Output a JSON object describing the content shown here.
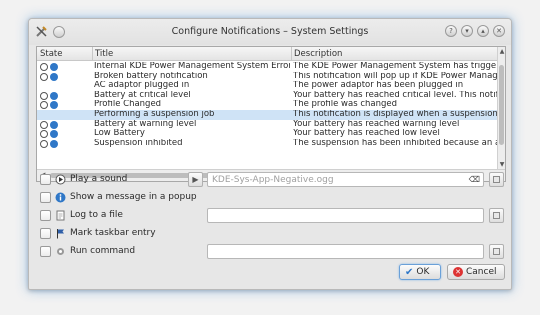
{
  "window": {
    "title": "Configure Notifications – System Settings"
  },
  "table": {
    "headers": {
      "state": "State",
      "title": "Title",
      "description": "Description"
    },
    "rows": [
      {
        "title": "Internal KDE Power Management System Error",
        "description": "The KDE Power Management System has trigge",
        "play": true,
        "info": true,
        "selected": false
      },
      {
        "title": "Broken battery notification",
        "description": "This notification will pop up if KDE Power Manage",
        "play": true,
        "info": true,
        "selected": false
      },
      {
        "title": "AC adaptor plugged in",
        "description": "The power adaptor has been plugged in",
        "play": false,
        "info": false,
        "selected": false
      },
      {
        "title": "Battery at critical level",
        "description": "Your battery has reached critical level. This notifi",
        "play": true,
        "info": true,
        "selected": false
      },
      {
        "title": "Profile Changed",
        "description": "The profile was changed",
        "play": true,
        "info": true,
        "selected": false
      },
      {
        "title": "Performing a suspension job",
        "description": "This notification is displayed when a suspension",
        "play": false,
        "info": false,
        "selected": true
      },
      {
        "title": "Battery at warning level",
        "description": "Your battery has reached warning level",
        "play": true,
        "info": true,
        "selected": false
      },
      {
        "title": "Low Battery",
        "description": "Your battery has reached low level",
        "play": true,
        "info": true,
        "selected": false
      },
      {
        "title": "Suspension inhibited",
        "description": "The suspension has been inhibited because an a",
        "play": true,
        "info": true,
        "selected": false
      }
    ]
  },
  "options": {
    "play_sound": "Play a sound",
    "sound_file": "KDE-Sys-App-Negative.ogg",
    "show_popup": "Show a message in a popup",
    "log_file": "Log to a file",
    "taskbar": "Mark taskbar entry",
    "run_command": "Run command"
  },
  "buttons": {
    "ok": "OK",
    "cancel": "Cancel"
  },
  "colors": {
    "selection": "#cfe3f6",
    "accent": "#2f77c7"
  }
}
